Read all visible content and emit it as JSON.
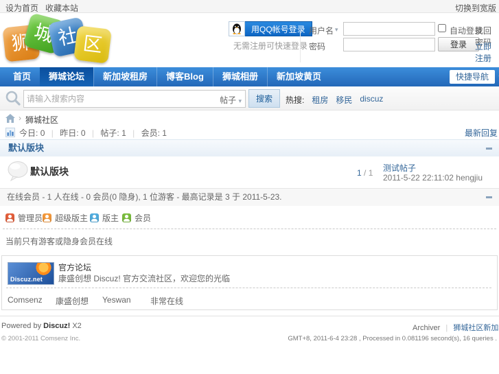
{
  "topbar": {
    "set_home": "设为首页",
    "bookmark": "收藏本站",
    "switch_wide": "切换到宽版"
  },
  "header": {
    "logo_chars": [
      "狮",
      "城",
      "社",
      "区"
    ],
    "logo_colors": [
      "#e2861c",
      "#56b32a",
      "#2c77bd",
      "#e3c312"
    ],
    "qq": {
      "button": "用QQ帐号登录",
      "note": "无需注册可快速登录"
    },
    "login": {
      "username_label": "用户名",
      "username_value": "",
      "password_label": "密码",
      "password_value": "",
      "auto_login": "自动登录",
      "login_button": "登录",
      "lost_password": "找回密码",
      "register": "立即注册"
    }
  },
  "nav": {
    "items": [
      {
        "label": "首页"
      },
      {
        "label": "狮城论坛"
      },
      {
        "label": "新加坡租房"
      },
      {
        "label": "博客Blog"
      },
      {
        "label": "狮城相册"
      },
      {
        "label": "新加坡黄页"
      }
    ],
    "quick": "快捷导航"
  },
  "search": {
    "placeholder": "请输入搜索内容",
    "scope": "帖子",
    "button": "搜索",
    "hot_label": "热搜:",
    "hot_links": [
      "租房",
      "移民",
      "discuz"
    ]
  },
  "breadcrumb": {
    "arrow": "›",
    "current": "狮城社区"
  },
  "stats": {
    "items": [
      {
        "label": "今日:",
        "value": "0"
      },
      {
        "label": "昨日:",
        "value": "0"
      },
      {
        "label": "帖子:",
        "value": "1"
      },
      {
        "label": "会员:",
        "value": "1"
      }
    ],
    "latest_link": "最新回复"
  },
  "category": {
    "title": "默认版块"
  },
  "forum": {
    "name": "默认版块",
    "threads": "1",
    "posts_suffix": " / 1",
    "last_title": "测试帖子",
    "last_meta": "2011-5-22 22:11:02 hengjiu"
  },
  "online": {
    "summary": "在线会员 - 1 人在线 - 0 会员(0 隐身), 1 位游客 - 最高记录是 3 于 2011-5-23.",
    "legend": [
      {
        "label": "管理员",
        "color": "#e5603c"
      },
      {
        "label": "超级版主",
        "color": "#f59a3c"
      },
      {
        "label": "版主",
        "color": "#52aee0"
      },
      {
        "label": "会员",
        "color": "#7cbf3f"
      }
    ],
    "guest_note": "当前只有游客或隐身会员在线"
  },
  "promo": {
    "banner_text": "Discuz.net",
    "title": "官方论坛",
    "desc": "康盛创想 Discuz! 官方交流社区，欢迎您的光临",
    "links": [
      "Comsenz",
      "康盛创想",
      "Yeswan",
      "非常在线"
    ]
  },
  "footer": {
    "powered_prefix": "Powered by ",
    "brand": "Discuz!",
    "version": " X2",
    "copyright": "© 2001-2011 Comsenz Inc.",
    "archiver": "Archiver",
    "site_link": "狮城社区新加坡华人论坛",
    "gmt": "GMT+8, 2011-6-4 23:28 , Processed in 0.081196 second(s), 16 queries ."
  },
  "colors": {
    "link_blue": "#336699",
    "nav_blue": "#2368b8",
    "qq_button_blue": "#0d66c4"
  }
}
